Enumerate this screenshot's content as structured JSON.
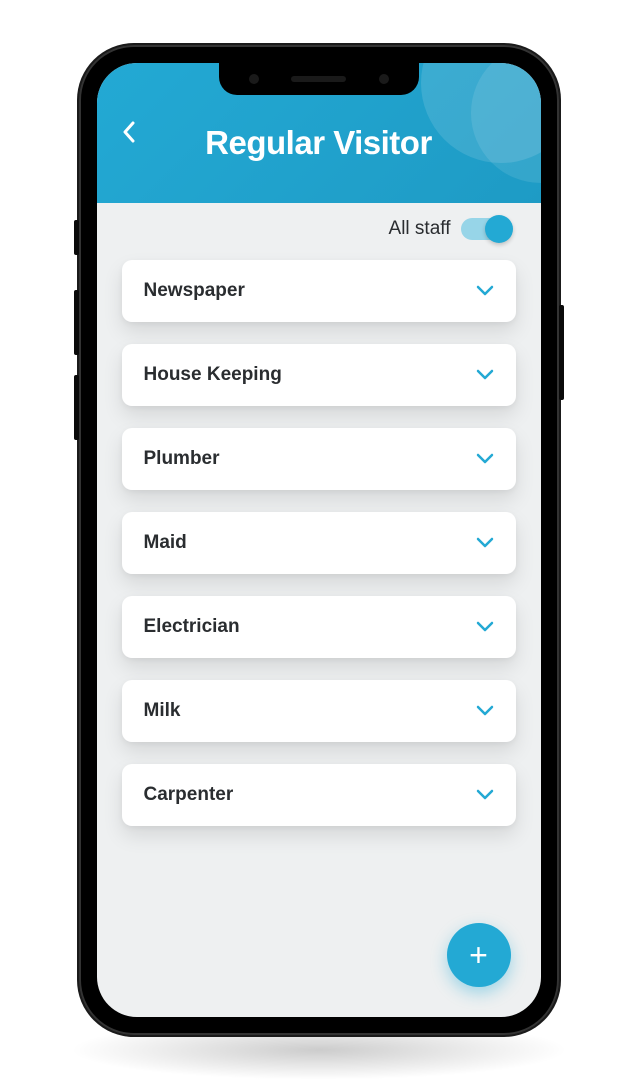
{
  "header": {
    "title": "Regular Visitor"
  },
  "toggle": {
    "label": "All staff",
    "state": true
  },
  "categories": [
    {
      "label": "Newspaper"
    },
    {
      "label": "House Keeping"
    },
    {
      "label": "Plumber"
    },
    {
      "label": "Maid"
    },
    {
      "label": "Electrician"
    },
    {
      "label": "Milk"
    },
    {
      "label": "Carpenter"
    }
  ],
  "fab": {
    "icon": "+"
  },
  "colors": {
    "primary": "#23A9D4",
    "background": "#EEF0F1",
    "text": "#2a2d30"
  }
}
